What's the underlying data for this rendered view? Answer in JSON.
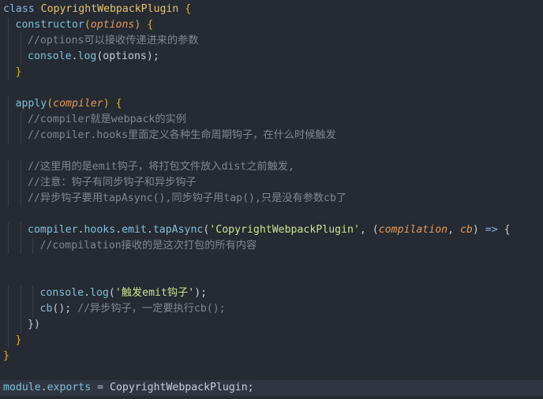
{
  "editor": {
    "lines": [
      {
        "indent": 0,
        "tokens": [
          [
            "kw",
            "class "
          ],
          [
            "cls",
            "CopyrightWebpackPlugin "
          ],
          [
            "br",
            "{"
          ]
        ]
      },
      {
        "indent": 1,
        "tokens": [
          [
            "fn",
            "constructor"
          ],
          [
            "br",
            "("
          ],
          [
            "prm",
            "options"
          ],
          [
            "br",
            ")"
          ],
          [
            "pl",
            " "
          ],
          [
            "br",
            "{"
          ]
        ]
      },
      {
        "indent": 2,
        "tokens": [
          [
            "cm",
            "//options可以接收传递进来的参数"
          ]
        ]
      },
      {
        "indent": 2,
        "tokens": [
          [
            "fn",
            "console"
          ],
          [
            "pl",
            "."
          ],
          [
            "fn",
            "log"
          ],
          [
            "pl",
            "(options);"
          ]
        ]
      },
      {
        "indent": 1,
        "tokens": [
          [
            "br",
            "}"
          ]
        ]
      },
      {
        "indent": 0,
        "tokens": []
      },
      {
        "indent": 1,
        "tokens": [
          [
            "fn",
            "apply"
          ],
          [
            "br",
            "("
          ],
          [
            "prm",
            "compiler"
          ],
          [
            "br",
            ")"
          ],
          [
            "pl",
            " "
          ],
          [
            "br",
            "{"
          ]
        ]
      },
      {
        "indent": 2,
        "tokens": [
          [
            "cm",
            "//compiler就是webpack的实例"
          ]
        ]
      },
      {
        "indent": 2,
        "tokens": [
          [
            "cm",
            "//compiler.hooks里面定义各种生命周期钩子，在什么时候触发"
          ]
        ]
      },
      {
        "indent": 0,
        "tokens": []
      },
      {
        "indent": 2,
        "tokens": [
          [
            "cm",
            "//这里用的是emit钩子，将打包文件放入dist之前触发,"
          ]
        ]
      },
      {
        "indent": 2,
        "tokens": [
          [
            "cm",
            "//注意：钩子有同步钩子和异步钩子"
          ]
        ]
      },
      {
        "indent": 2,
        "tokens": [
          [
            "cm",
            "//异步钩子要用tapAsync(),同步钩子用tap(),只是没有参数cb了"
          ]
        ]
      },
      {
        "indent": 0,
        "tokens": []
      },
      {
        "indent": 2,
        "tokens": [
          [
            "fn",
            "compiler"
          ],
          [
            "pl",
            "."
          ],
          [
            "fn",
            "hooks"
          ],
          [
            "pl",
            "."
          ],
          [
            "fn",
            "emit"
          ],
          [
            "pl",
            "."
          ],
          [
            "fn",
            "tapAsync"
          ],
          [
            "pl",
            "("
          ],
          [
            "str",
            "'CopyrightWebpackPlugin'"
          ],
          [
            "pl",
            ", ("
          ],
          [
            "prm",
            "compilation"
          ],
          [
            "pl",
            ", "
          ],
          [
            "prm",
            "cb"
          ],
          [
            "pl",
            ") "
          ],
          [
            "kw",
            "=>"
          ],
          [
            "pl",
            " {"
          ]
        ]
      },
      {
        "indent": 3,
        "tokens": [
          [
            "cm",
            "//compilation接收的是这次打包的所有内容"
          ]
        ]
      },
      {
        "indent": 0,
        "tokens": []
      },
      {
        "indent": 0,
        "tokens": []
      },
      {
        "indent": 3,
        "tokens": [
          [
            "fn",
            "console"
          ],
          [
            "pl",
            "."
          ],
          [
            "fn",
            "log"
          ],
          [
            "pl",
            "("
          ],
          [
            "str",
            "'触发emit钩子'"
          ],
          [
            "pl",
            ");"
          ]
        ]
      },
      {
        "indent": 3,
        "tokens": [
          [
            "fn",
            "cb"
          ],
          [
            "pl",
            "(); "
          ],
          [
            "cm",
            "//异步钩子，一定要执行cb();"
          ]
        ]
      },
      {
        "indent": 2,
        "tokens": [
          [
            "pl",
            "})"
          ]
        ]
      },
      {
        "indent": 1,
        "tokens": [
          [
            "br",
            "}"
          ]
        ]
      },
      {
        "indent": 0,
        "tokens": [
          [
            "br",
            "}"
          ]
        ]
      },
      {
        "indent": 0,
        "tokens": []
      },
      {
        "indent": 0,
        "active": true,
        "tokens": [
          [
            "fn",
            "module"
          ],
          [
            "pl",
            "."
          ],
          [
            "fn",
            "exports"
          ],
          [
            "op",
            " = "
          ],
          [
            "pl",
            "CopyrightWebpackPlugin;"
          ]
        ]
      }
    ]
  }
}
